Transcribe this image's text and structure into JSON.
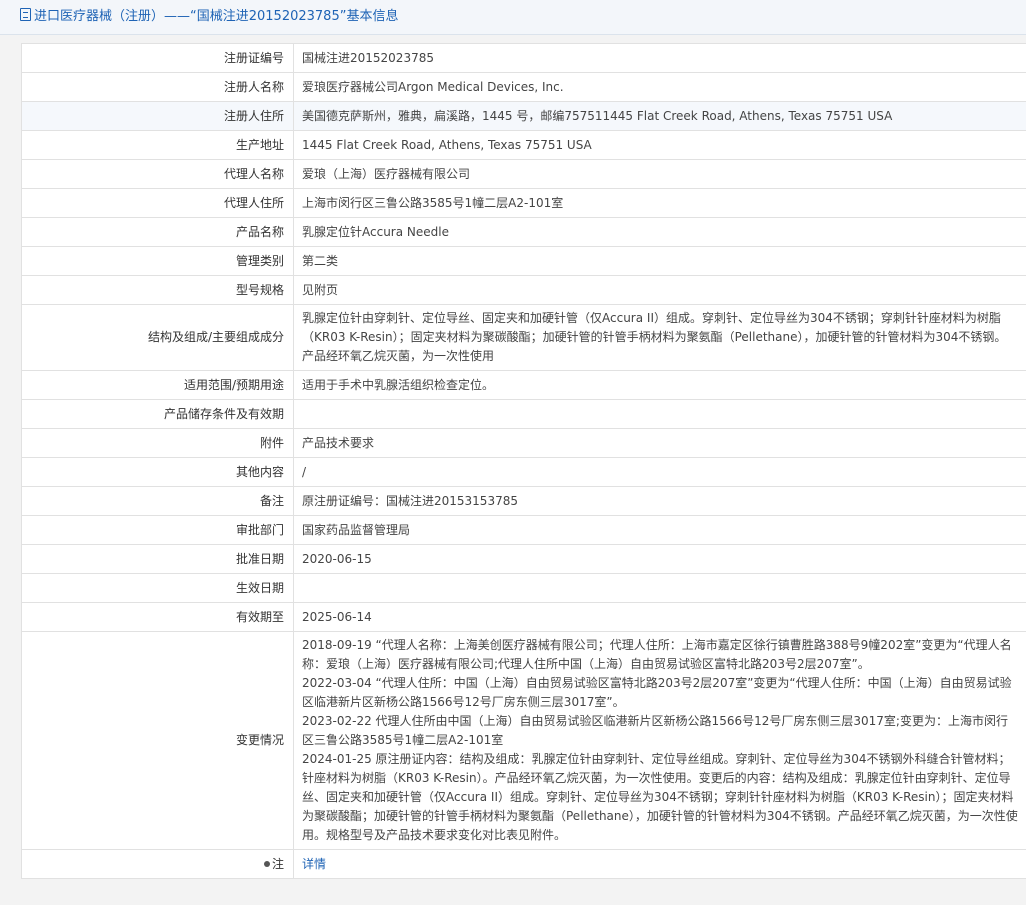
{
  "header": {
    "title": "进口医疗器械（注册）——“国械注进20152023785”基本信息"
  },
  "rows": [
    {
      "label": "注册证编号",
      "value": "国械注进20152023785"
    },
    {
      "label": "注册人名称",
      "value": "爱琅医疗器械公司Argon Medical Devices, Inc."
    },
    {
      "label": "注册人住所",
      "value": "美国德克萨斯州，雅典，扁溪路，1445 号，邮编757511445 Flat Creek Road, Athens, Texas 75751 USA"
    },
    {
      "label": "生产地址",
      "value": "1445 Flat Creek Road, Athens, Texas 75751 USA"
    },
    {
      "label": "代理人名称",
      "value": "爱琅（上海）医疗器械有限公司"
    },
    {
      "label": "代理人住所",
      "value": "上海市闵行区三鲁公路3585号1幢二层A2-101室"
    },
    {
      "label": "产品名称",
      "value": "乳腺定位针Accura Needle"
    },
    {
      "label": "管理类别",
      "value": "第二类"
    },
    {
      "label": "型号规格",
      "value": "见附页"
    },
    {
      "label": "结构及组成/主要组成成分",
      "value": "乳腺定位针由穿刺针、定位导丝、固定夹和加硬针管（仅Accura II）组成。穿刺针、定位导丝为304不锈钢；穿刺针针座材料为树脂（KR03 K-Resin）；固定夹材料为聚碳酸酯；加硬针管的针管手柄材料为聚氨酯（Pellethane），加硬针管的针管材料为304不锈钢。产品经环氧乙烷灭菌，为一次性使用"
    },
    {
      "label": "适用范围/预期用途",
      "value": "适用于手术中乳腺活组织检查定位。"
    },
    {
      "label": "产品储存条件及有效期",
      "value": ""
    },
    {
      "label": "附件",
      "value": "产品技术要求"
    },
    {
      "label": "其他内容",
      "value": "/"
    },
    {
      "label": "备注",
      "value": "原注册证编号：国械注进20153153785"
    },
    {
      "label": "审批部门",
      "value": "国家药品监督管理局"
    },
    {
      "label": "批准日期",
      "value": "2020-06-15"
    },
    {
      "label": "生效日期",
      "value": ""
    },
    {
      "label": "有效期至",
      "value": "2025-06-14"
    }
  ],
  "changes": {
    "label": "变更情况",
    "entries": [
      "2018-09-19 “代理人名称：上海美创医疗器械有限公司；代理人住所：上海市嘉定区徐行镇曹胜路388号9幢202室”变更为“代理人名称：爱琅（上海）医疗器械有限公司;代理人住所中国（上海）自由贸易试验区富特北路203号2层207室”。",
      "2022-03-04 “代理人住所：中国（上海）自由贸易试验区富特北路203号2层207室”变更为“代理人住所：中国（上海）自由贸易试验区临港新片区新杨公路1566号12号厂房东侧三层3017室”。",
      "2023-02-22 代理人住所由中国（上海）自由贸易试验区临港新片区新杨公路1566号12号厂房东侧三层3017室;变更为：上海市闵行区三鲁公路3585号1幢二层A2-101室",
      "2024-01-25 原注册证内容：结构及组成：乳腺定位针由穿刺针、定位导丝组成。穿刺针、定位导丝为304不锈钢外科缝合针管材料；针座材料为树脂（KR03 K-Resin）。产品经环氧乙烷灭菌，为一次性使用。变更后的内容：结构及组成：乳腺定位针由穿刺针、定位导丝、固定夹和加硬针管（仅Accura II）组成。穿刺针、定位导丝为304不锈钢；穿刺针针座材料为树脂（KR03 K-Resin）；固定夹材料为聚碳酸酯；加硬针管的针管手柄材料为聚氨酯（Pellethane），加硬针管的针管材料为304不锈钢。产品经环氧乙烷灭菌，为一次性使用。规格型号及产品技术要求变化对比表见附件。"
    ]
  },
  "note": {
    "label": "注",
    "link_text": "详情"
  }
}
